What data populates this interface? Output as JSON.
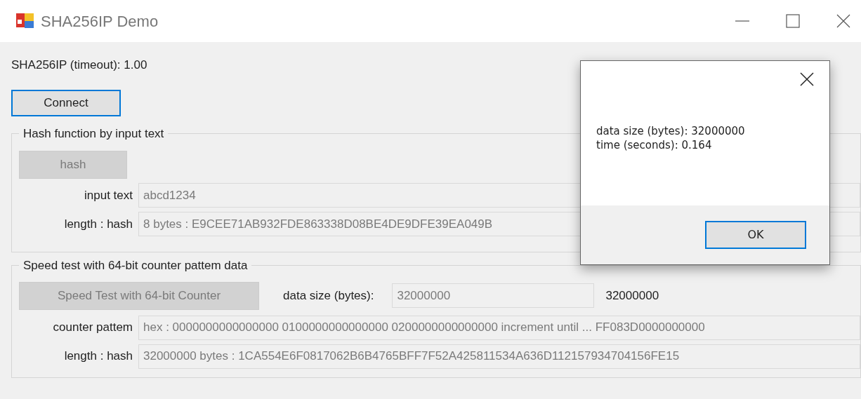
{
  "window": {
    "title": "SHA256IP Demo"
  },
  "status_line": "SHA256IP (timeout): 1.00",
  "connect_button": {
    "label": "Connect",
    "disabled": false,
    "focused": true
  },
  "hash_group": {
    "title": "Hash function by input text",
    "button": {
      "label": "hash",
      "disabled": true
    },
    "rows": [
      {
        "label": "input text",
        "value": "abcd1234",
        "disabled": true
      },
      {
        "label": "length : hash",
        "value": "8 bytes : E9CEE71AB932FDE863338D08BE4DE9DFE39EA049B",
        "disabled": true
      }
    ]
  },
  "speed_group": {
    "title": "Speed test with 64-bit counter pattem data",
    "button": {
      "label": "Speed Test with 64-bit Counter",
      "disabled": true
    },
    "size_label": "data size (bytes):",
    "size_value": "32000000",
    "size_disabled": true,
    "size_reading": "32000000",
    "rows": [
      {
        "label": "counter pattem",
        "value": "hex : 0000000000000000 0100000000000000 0200000000000000 increment until ... FF083D0000000000",
        "disabled": true
      },
      {
        "label": "length : hash",
        "value": "32000000 bytes : 1CA554E6F0817062B6B4765BFF7F52A425811534A636D112157934704156FE15",
        "disabled": true
      }
    ]
  },
  "dialog": {
    "lines": [
      "data size (bytes): 32000000",
      "time (seconds): 0.164"
    ],
    "button": {
      "label": "OK",
      "disabled": false,
      "focused": true
    }
  }
}
